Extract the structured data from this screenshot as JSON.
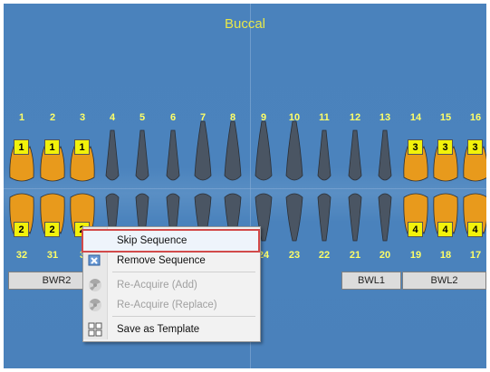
{
  "chart_title": "Buccal",
  "upper_numbers": [
    "1",
    "2",
    "3",
    "4",
    "5",
    "6",
    "7",
    "8",
    "9",
    "10",
    "11",
    "12",
    "13",
    "14",
    "15",
    "16"
  ],
  "lower_numbers": [
    "32",
    "31",
    "3",
    "",
    "",
    "",
    "",
    "",
    "24",
    "23",
    "22",
    "21",
    "20",
    "19",
    "18",
    "17"
  ],
  "seq_markers": {
    "upper": [
      "1",
      "1",
      "1",
      "3",
      "3",
      "3"
    ],
    "lower": [
      "2",
      "2",
      "2",
      "4",
      "4",
      "4"
    ]
  },
  "groups": {
    "bwr2": "BWR2",
    "bwl1": "BWL1",
    "bwl2": "BWL2"
  },
  "menu": {
    "skip": "Skip Sequence",
    "remove": "Remove Sequence",
    "reacquire_add": "Re-Acquire (Add)",
    "reacquire_replace": "Re-Acquire (Replace)",
    "save_template": "Save as Template"
  },
  "colors": {
    "background": "#4a82bc",
    "title": "#e8e84a",
    "numbers": "#ffff66",
    "tooth_gray": "#4a5563",
    "tooth_orange": "#e89a1c",
    "marker": "#f2f20a",
    "selection_outline": "#d24a4a"
  }
}
